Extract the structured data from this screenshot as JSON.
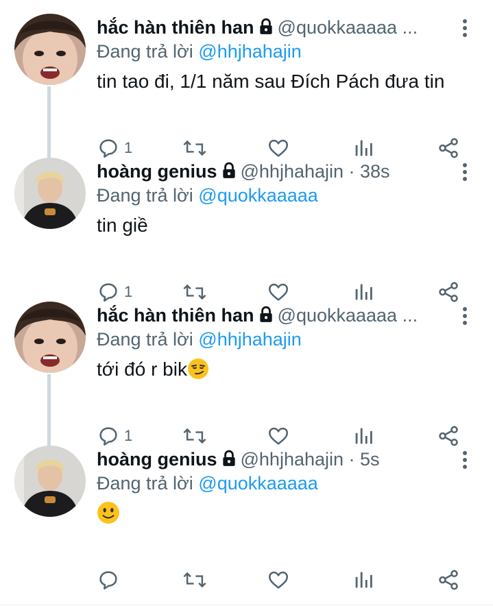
{
  "reply_prefix": "Đang trả lời",
  "tweets": [
    {
      "name": "hắc hàn thiên han",
      "handle": "@quokkaaaaa ...",
      "reply_to": "@hhjhahajin",
      "text": "tin tao đi, 1/1 năm sau Đích Pách đưa tin",
      "reply_count": "1",
      "avatar": "avatar-1"
    },
    {
      "name": "hoàng genius",
      "handle": "@hhjhahajin · 38s",
      "reply_to": "@quokkaaaaa",
      "text": "tin giề",
      "reply_count": "1",
      "avatar": "avatar-2"
    },
    {
      "name": "hắc hàn thiên han",
      "handle": "@quokkaaaaa ...",
      "reply_to": "@hhjhahajin",
      "text": "tới đó r bik",
      "emoji": "smirking-face",
      "reply_count": "1",
      "avatar": "avatar-1"
    },
    {
      "name": "hoàng genius",
      "handle": "@hhjhahajin · 5s",
      "reply_to": "@quokkaaaaa",
      "text": "",
      "emoji": "slightly-smiling-face",
      "reply_count": "",
      "avatar": "avatar-2"
    }
  ],
  "icons": {
    "lock": "lock-icon",
    "more": "more-dots-icon",
    "reply": "reply-icon",
    "retweet": "retweet-icon",
    "like": "heart-icon",
    "views": "analytics-icon",
    "share": "share-icon"
  },
  "colors": {
    "link": "#1d9bf0",
    "secondary": "#536471",
    "text": "#0f1419",
    "thread_line": "#cfd9de"
  }
}
